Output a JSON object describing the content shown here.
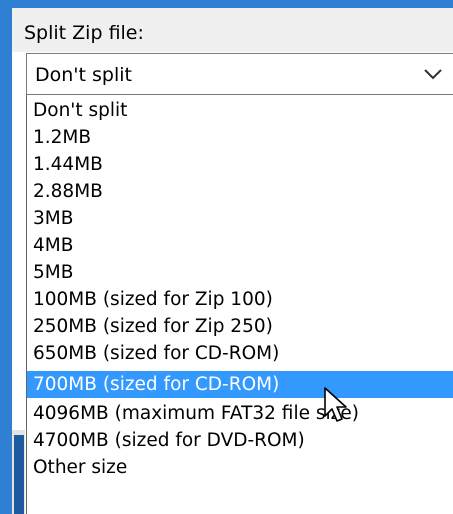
{
  "dialog": {
    "field_label": "Split Zip file:",
    "combo": {
      "selected_value": "Don't split",
      "arrow_icon": "chevron-down-icon"
    },
    "options": [
      "Don't split",
      "1.2MB",
      "1.44MB",
      "2.88MB",
      "3MB",
      "4MB",
      "5MB",
      "100MB (sized for Zip 100)",
      "250MB (sized for Zip 250)",
      "650MB (sized for CD-ROM)",
      "700MB (sized for CD-ROM)",
      "4096MB (maximum FAT32 file size)",
      "4700MB (sized for DVD-ROM)",
      "Other size"
    ],
    "highlighted_option_index": 10,
    "cursor_icon": "mouse-pointer-icon"
  },
  "colors": {
    "highlight": "#3399ff",
    "highlight_text": "#ffffff",
    "window_accent": "#2f7fd3"
  }
}
